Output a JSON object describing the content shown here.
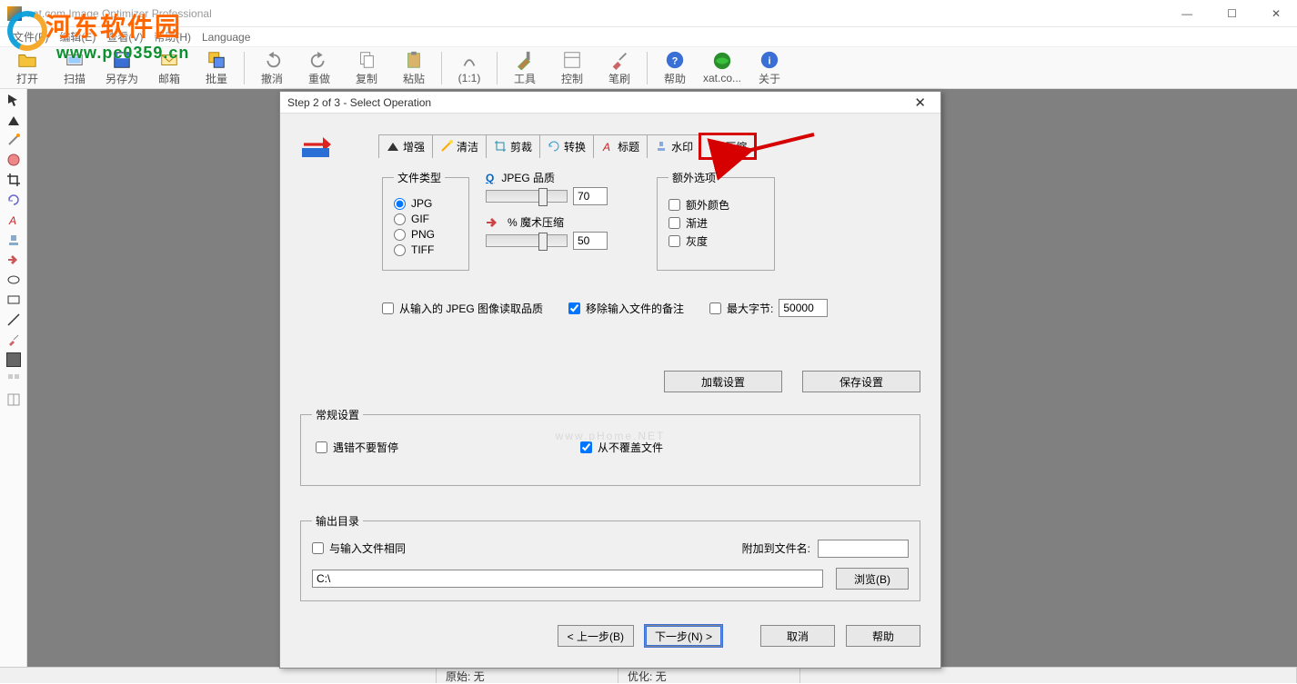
{
  "app": {
    "title": "xat.com  Image Optimizer Professional"
  },
  "menu": {
    "file": "文件(F)",
    "edit": "编辑(E)",
    "view": "查看(V)",
    "help": "帮助(H)",
    "language": "Language"
  },
  "toolbar": {
    "open": "打开",
    "scan": "扫描",
    "saveas": "另存为",
    "mail": "邮箱",
    "batch": "批量",
    "undo": "撤消",
    "redo": "重做",
    "copy": "复制",
    "paste": "粘贴",
    "ratio": "(1:1)",
    "tools": "工具",
    "control": "控制",
    "brush": "笔刷",
    "helpbtn": "帮助",
    "xat": "xat.co...",
    "about": "关于"
  },
  "status": {
    "orig": "原始: 无",
    "opt": "优化: 无"
  },
  "watermark": {
    "line1": "河东软件园",
    "line2": "www.pc0359.cn"
  },
  "dialog": {
    "title": "Step 2 of 3 - Select Operation",
    "tabs": {
      "enhance": "增强",
      "clean": "清洁",
      "crop": "剪裁",
      "convert": "转换",
      "caption": "标题",
      "watermark": "水印",
      "compress": "压缩"
    },
    "filetype": {
      "legend": "文件类型",
      "jpg": "JPG",
      "gif": "GIF",
      "png": "PNG",
      "tiff": "TIFF"
    },
    "quality": {
      "jpeg_label": "JPEG 品质",
      "jpeg_val": "70",
      "magic_label": "% 魔术压缩",
      "magic_val": "50"
    },
    "extra": {
      "legend": "额外选项",
      "extracolor": "额外颜色",
      "progressive": "渐进",
      "grayscale": "灰度"
    },
    "checks": {
      "readq": "从输入的 JPEG 图像读取品质",
      "removecomment": "移除输入文件的备注",
      "maxbytes_label": "最大字节:",
      "maxbytes_val": "50000"
    },
    "buttons": {
      "load": "加载设置",
      "save": "保存设置"
    },
    "general": {
      "legend": "常规设置",
      "nopause": "遇错不要暂停",
      "nooverwrite": "从不覆盖文件"
    },
    "outdir": {
      "legend": "输出目录",
      "sameasinput": "与输入文件相同",
      "appendlabel": "附加到文件名:",
      "appendval": "",
      "path": "C:\\",
      "browse": "浏览(B)"
    },
    "footer": {
      "back": "< 上一步(B)",
      "next": "下一步(N) >",
      "cancel": "取消",
      "help": "帮助"
    },
    "faint": "www.pHome.NET"
  }
}
